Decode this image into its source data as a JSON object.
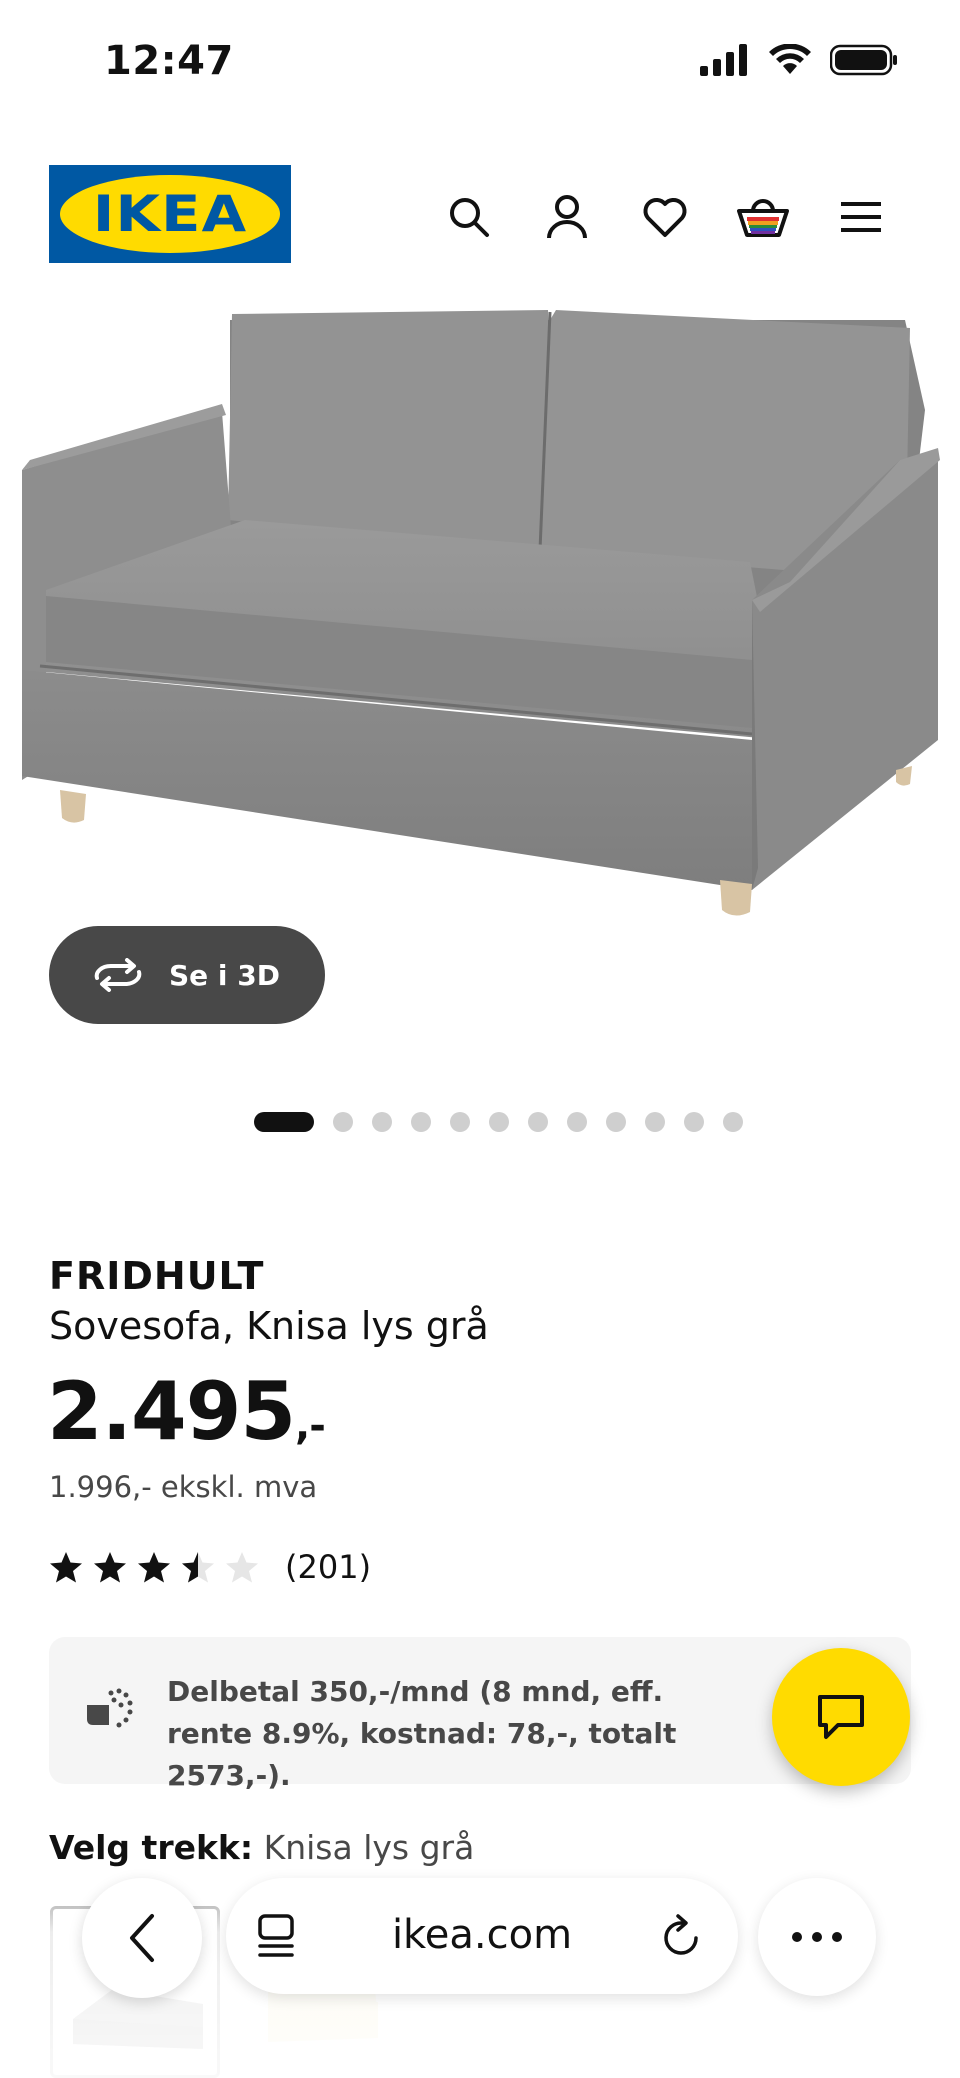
{
  "status_bar": {
    "time": "12:47"
  },
  "header": {
    "logo_text": "IKEA",
    "icons": [
      "search-icon",
      "account-icon",
      "heart-icon",
      "basket-icon",
      "menu-icon"
    ]
  },
  "gallery": {
    "view_3d_label": "Se i 3D",
    "dot_count": 12,
    "active_dot": 0
  },
  "product": {
    "name": "FRIDHULT",
    "description": "Sovesofa, Knisa lys grå",
    "price_main": "2.495",
    "price_suffix": ",-",
    "price_ex_vat": "1.996,- ekskl. mva",
    "rating_value": 3.5,
    "rating_max": 5,
    "rating_count": "(201)"
  },
  "installment": {
    "text": "Delbetal 350,-/mnd (8 mnd, eff. rente 8.9%, kostnad: 78,-, totalt 2573,-)."
  },
  "cover": {
    "label": "Velg trekk:",
    "value": "Knisa lys grå"
  },
  "browser": {
    "url": "ikea.com"
  },
  "colors": {
    "ikea_blue": "#0058a3",
    "ikea_yellow": "#ffdb00",
    "sofa_grey": "#8f8f8f",
    "dark_button": "#484848"
  }
}
